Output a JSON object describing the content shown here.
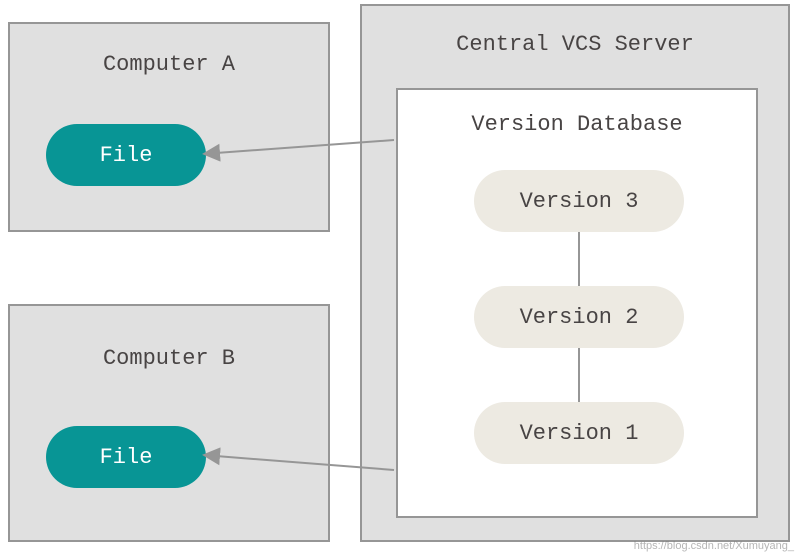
{
  "computerA": {
    "title": "Computer A",
    "file": "File"
  },
  "computerB": {
    "title": "Computer B",
    "file": "File"
  },
  "server": {
    "title": "Central VCS Server",
    "database": {
      "title": "Version Database",
      "versions": [
        "Version 3",
        "Version 2",
        "Version 1"
      ]
    }
  },
  "watermark": "https://blog.csdn.net/Xumuyang_"
}
